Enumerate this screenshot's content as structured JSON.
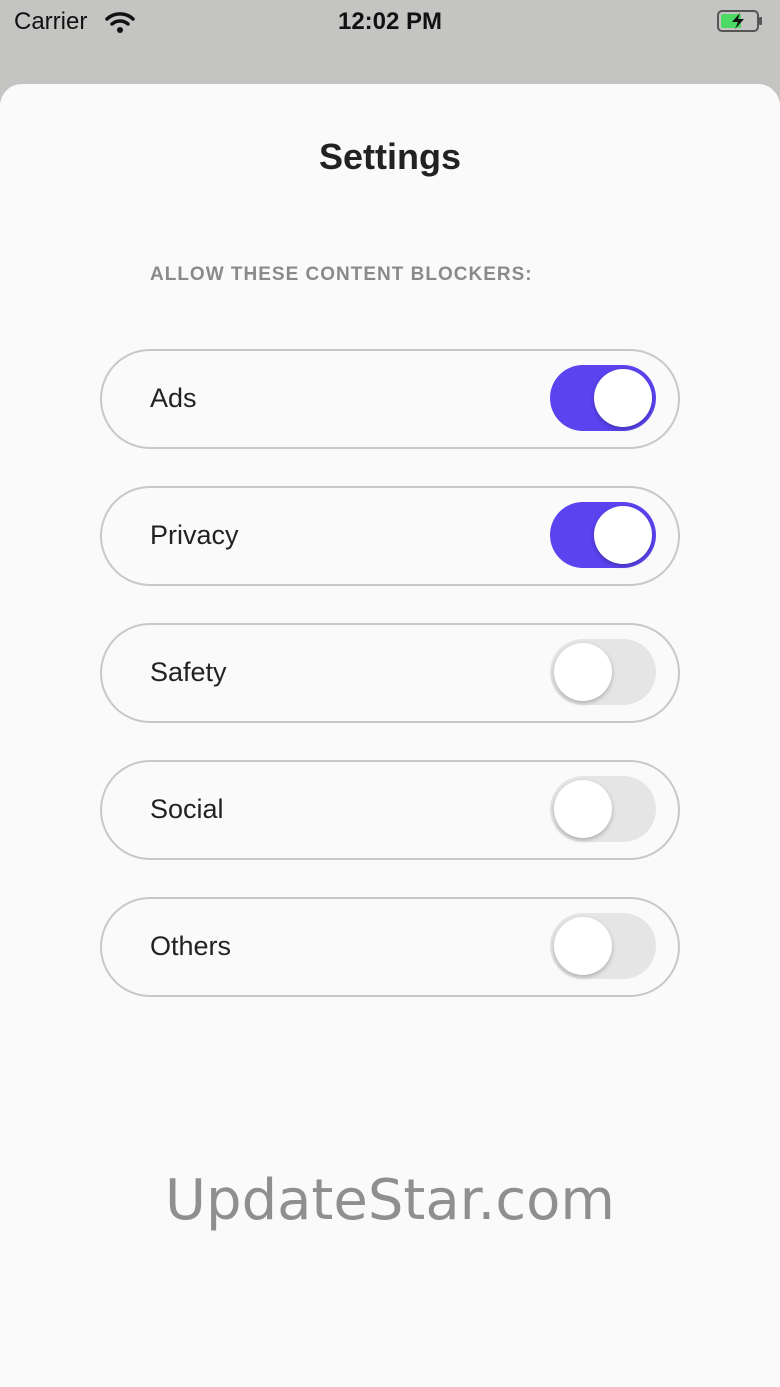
{
  "status_bar": {
    "carrier": "Carrier",
    "time": "12:02 PM",
    "wifi_icon": "wifi-icon",
    "battery_icon": "battery-charging-icon"
  },
  "screen": {
    "title": "Settings",
    "section_header": "ALLOW THESE CONTENT BLOCKERS:"
  },
  "blockers": [
    {
      "label": "Ads",
      "enabled": true
    },
    {
      "label": "Privacy",
      "enabled": true
    },
    {
      "label": "Safety",
      "enabled": false
    },
    {
      "label": "Social",
      "enabled": false
    },
    {
      "label": "Others",
      "enabled": false
    }
  ],
  "colors": {
    "accent": "#5b43f0",
    "toggle_off": "#e5e5e5",
    "battery_green": "#4cd964"
  },
  "watermark": "UpdateStar.com"
}
